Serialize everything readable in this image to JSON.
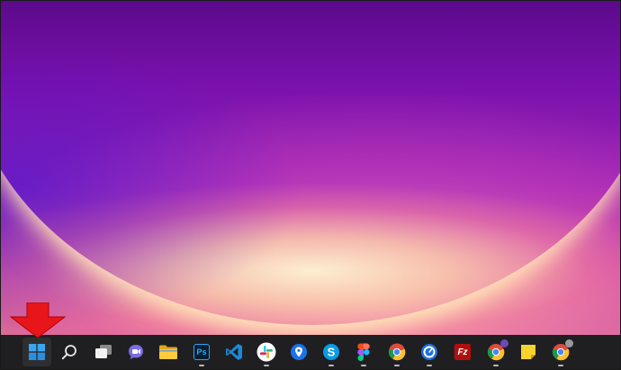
{
  "wallpaper": {
    "colors": {
      "top": "#5b0a8c",
      "mid": "#9a24b4",
      "glow": "#fff2cc"
    }
  },
  "taskbar": {
    "background": "#1f1f22",
    "items": [
      {
        "name": "start-button",
        "icon": "windows-icon"
      },
      {
        "name": "search-button",
        "icon": "search-icon"
      },
      {
        "name": "task-view-button",
        "icon": "task-view-icon"
      },
      {
        "name": "teams-chat-button",
        "icon": "chat-icon"
      },
      {
        "name": "file-explorer-button",
        "icon": "folder-icon"
      },
      {
        "name": "photoshop-button",
        "icon": "photoshop-icon",
        "label": "Ps"
      },
      {
        "name": "vscode-button",
        "icon": "vscode-icon"
      },
      {
        "name": "slack-button",
        "icon": "slack-icon"
      },
      {
        "name": "maps-button",
        "icon": "map-pin-icon"
      },
      {
        "name": "skype-button",
        "icon": "skype-icon",
        "label": "S"
      },
      {
        "name": "figma-button",
        "icon": "figma-icon"
      },
      {
        "name": "chrome-button",
        "icon": "chrome-icon"
      },
      {
        "name": "clockify-button",
        "icon": "clock-icon"
      },
      {
        "name": "filezilla-button",
        "icon": "filezilla-icon",
        "label": "Fz"
      },
      {
        "name": "chrome-profile-button",
        "icon": "chrome-icon"
      },
      {
        "name": "sticky-notes-button",
        "icon": "sticky-note-icon"
      },
      {
        "name": "chrome-profile-2-button",
        "icon": "chrome-icon"
      }
    ]
  },
  "annotation": {
    "icon": "red-arrow-icon",
    "color": "#e8161b"
  }
}
